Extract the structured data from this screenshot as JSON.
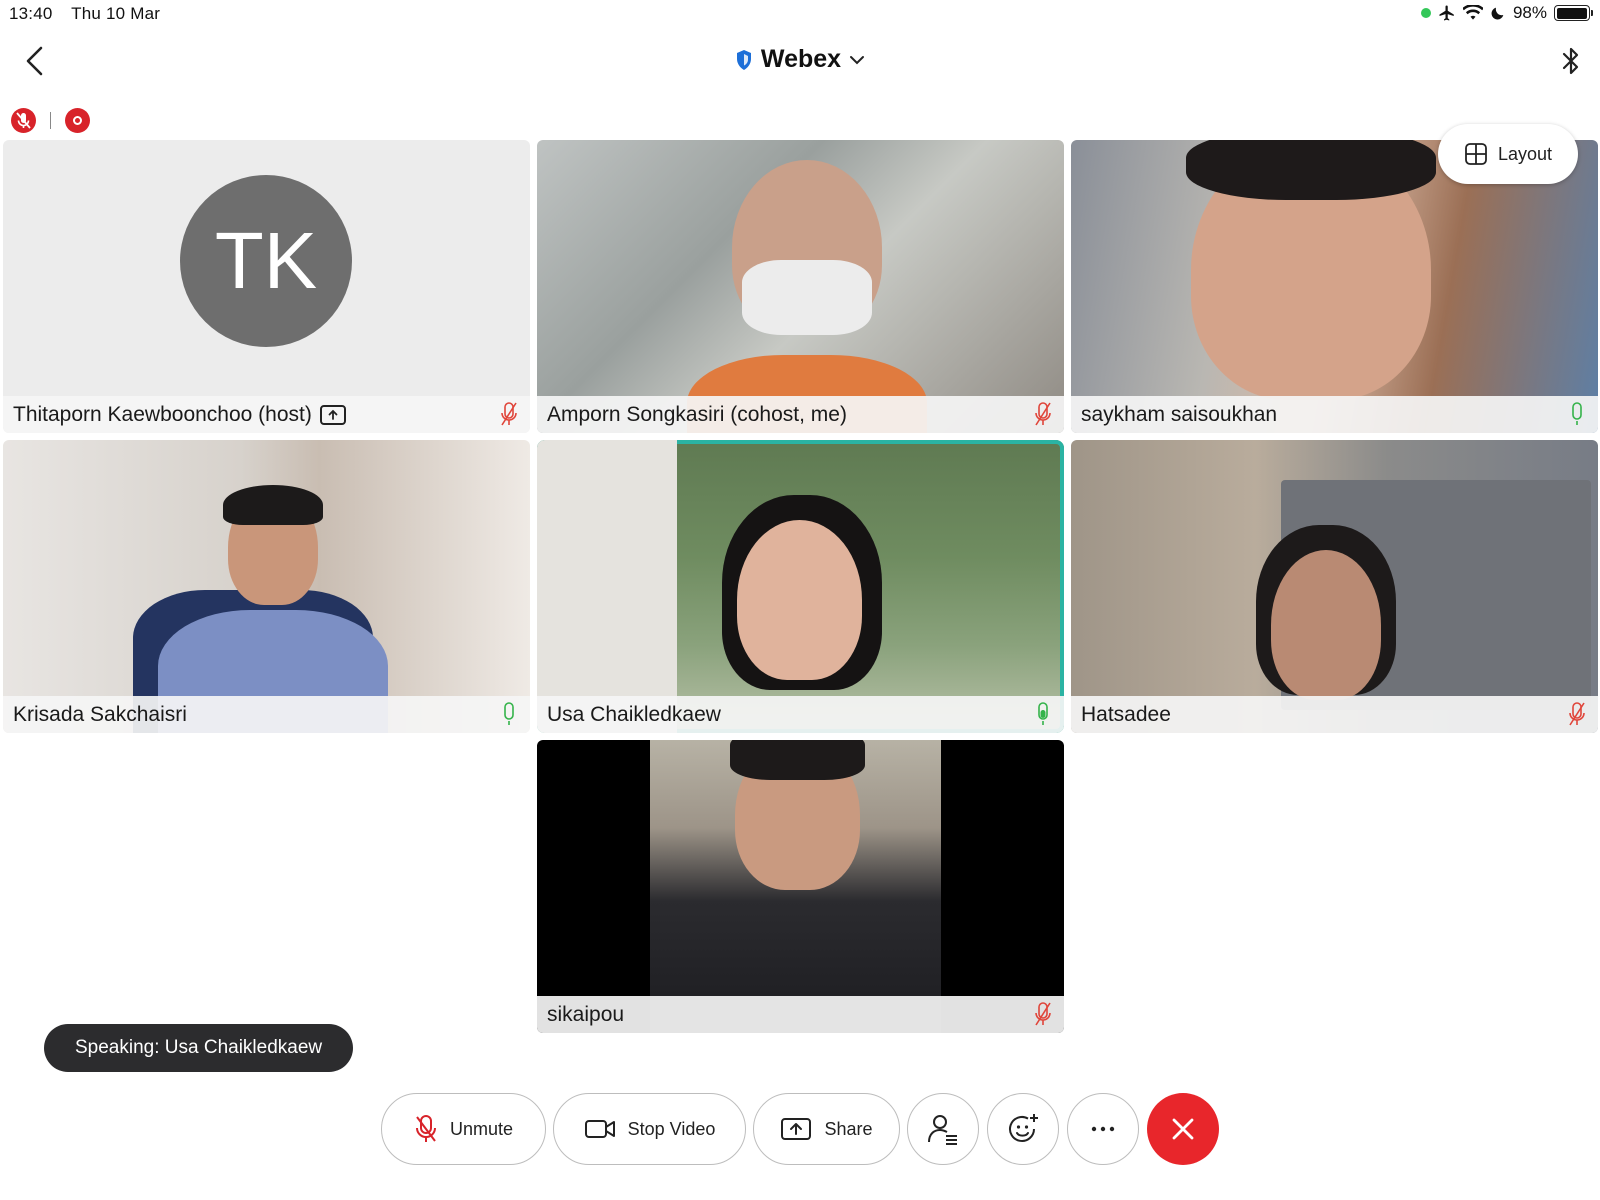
{
  "status_bar": {
    "time": "13:40",
    "date": "Thu 10 Mar",
    "battery": "98%",
    "battery_level": 0.98
  },
  "header": {
    "title": "Webex"
  },
  "layout_button": {
    "label": "Layout"
  },
  "participants": [
    {
      "name": "Thitaporn Kaewboonchoo (host)",
      "initials": "TK",
      "mic": "muted"
    },
    {
      "name": "Amporn Songkasiri (cohost, me)",
      "mic": "muted"
    },
    {
      "name": "saykham saisoukhan",
      "mic": "on"
    },
    {
      "name": "Krisada Sakchaisri",
      "mic": "on"
    },
    {
      "name": "Usa Chaikledkaew",
      "mic": "speaking"
    },
    {
      "name": "Hatsadee",
      "mic": "muted"
    },
    {
      "name": "sikaipou",
      "mic": "muted"
    }
  ],
  "speaking_toast": "Speaking: Usa Chaikledkaew",
  "controls": {
    "unmute": "Unmute",
    "stop_video": "Stop Video",
    "share": "Share"
  },
  "colors": {
    "active_speaker_border": "#2bb3a3",
    "muted_mic": "#e0453a",
    "end_call": "#e8262b",
    "mic_on": "#34b34a"
  }
}
